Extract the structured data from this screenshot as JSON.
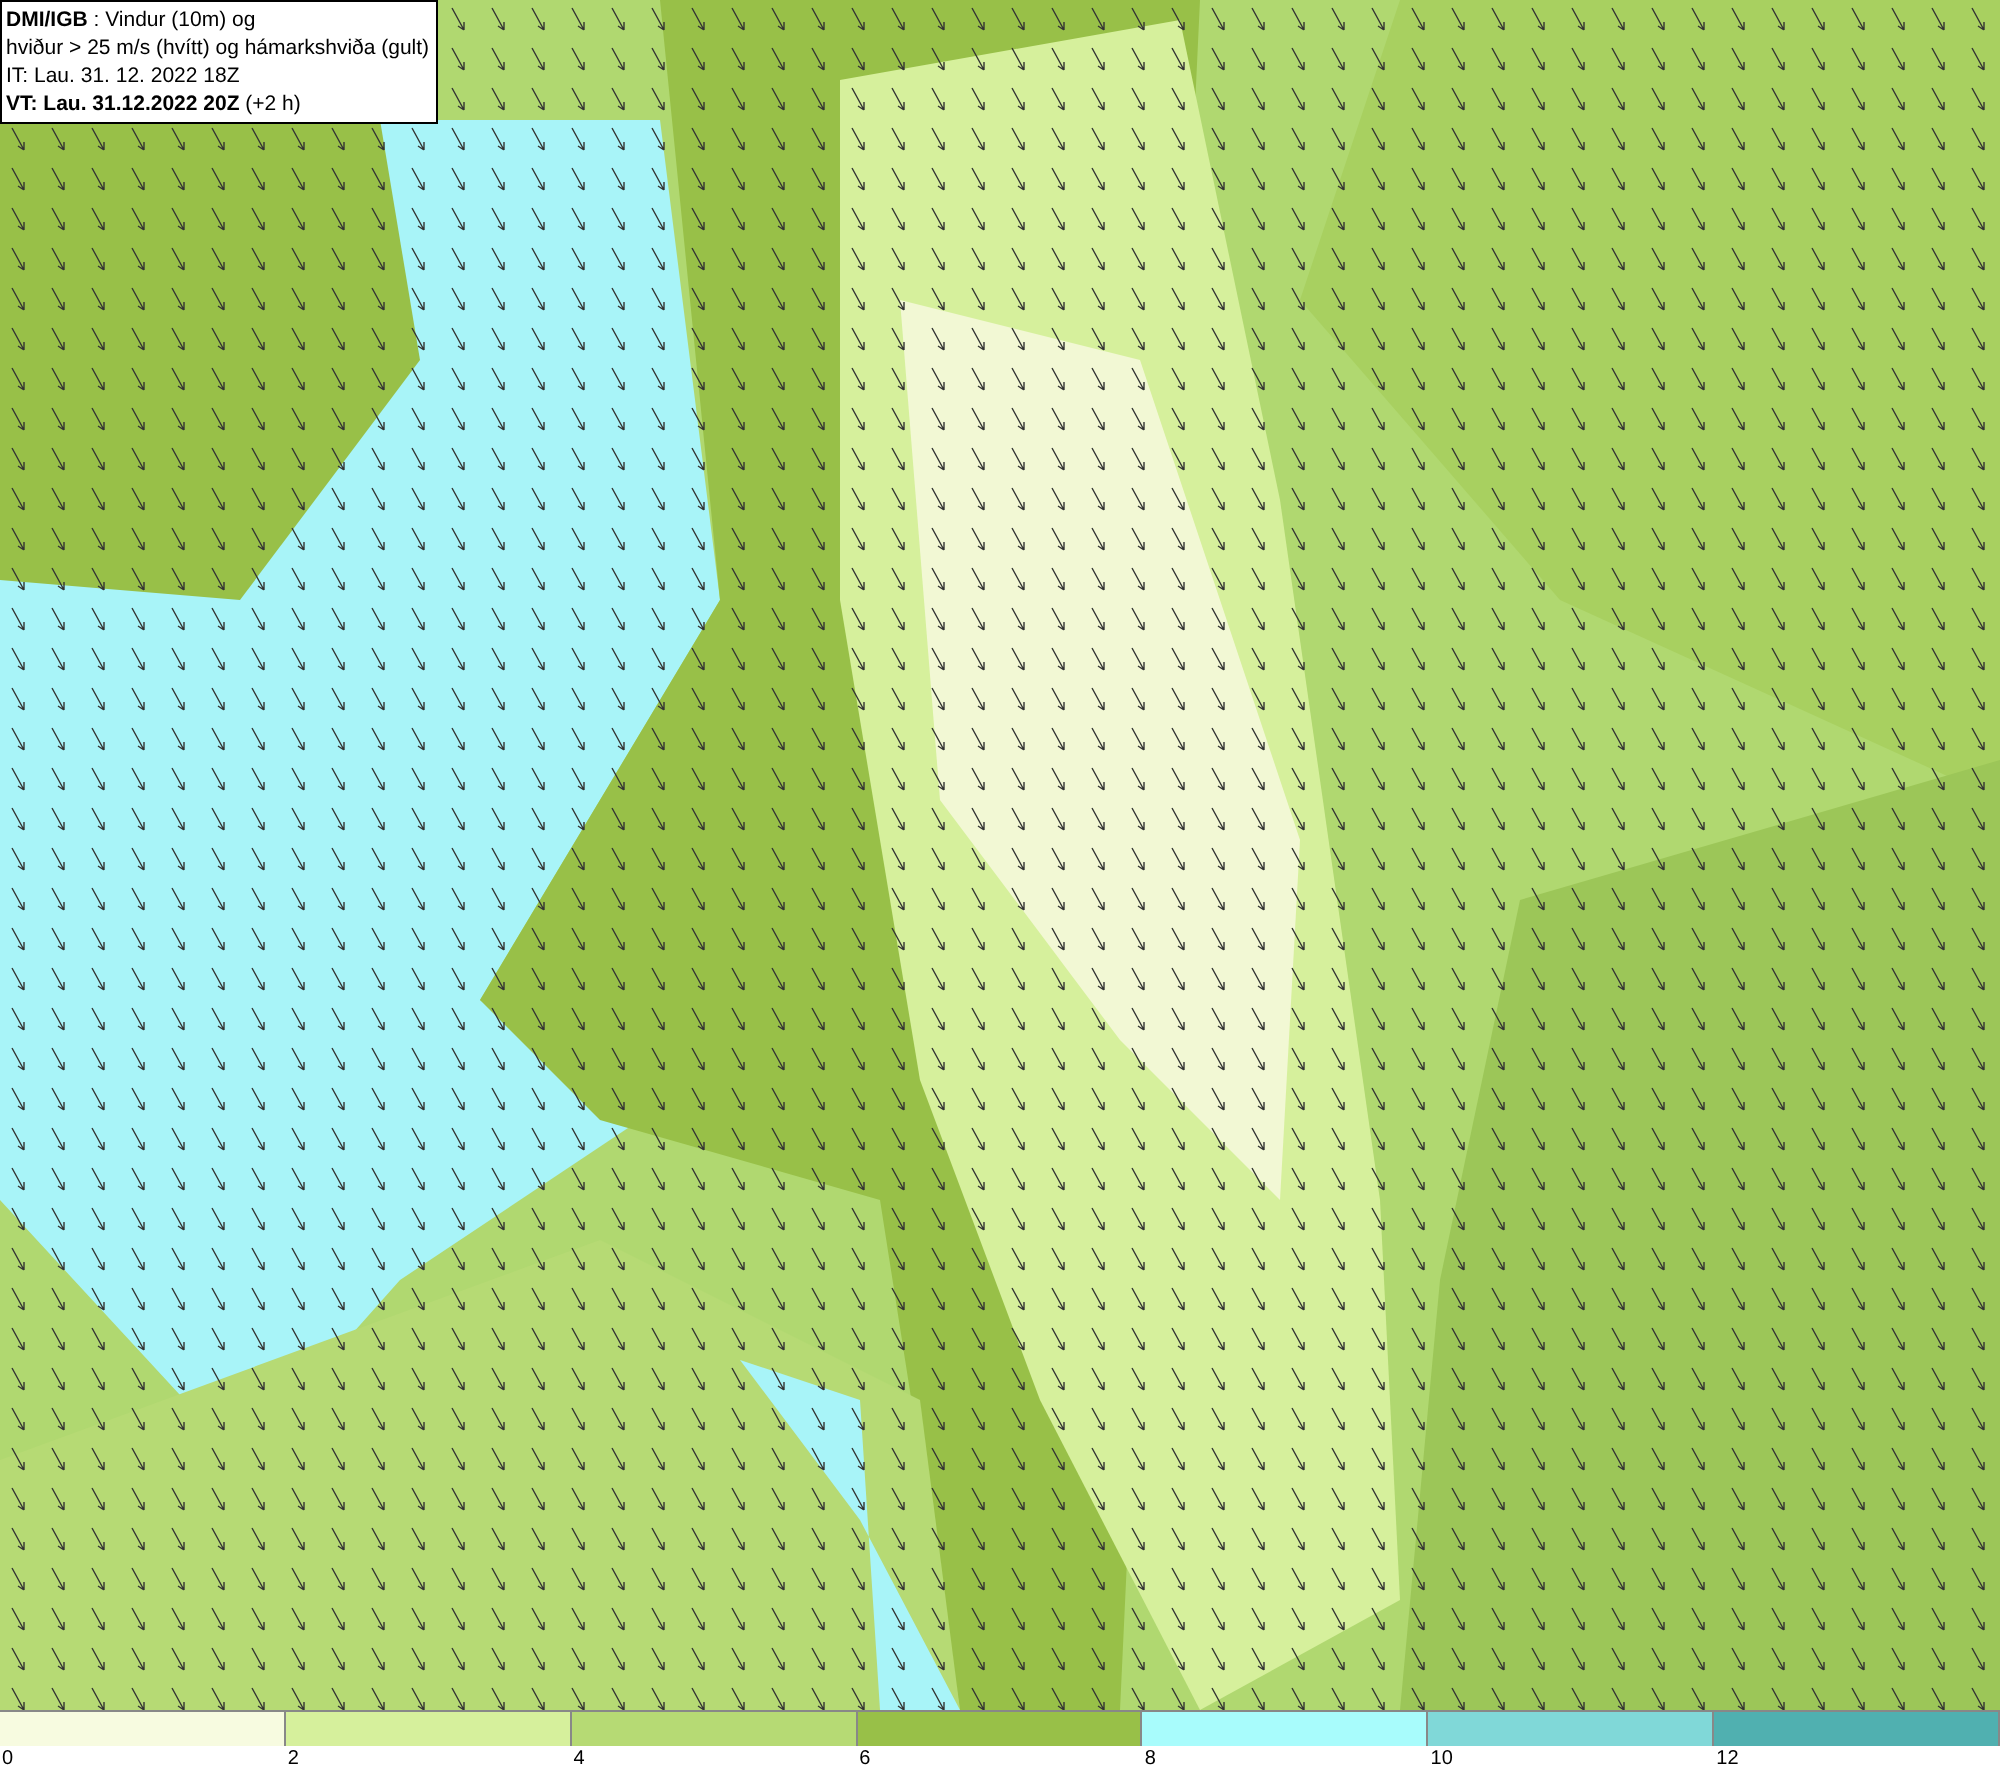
{
  "info_box": {
    "lines": [
      "**DMI/IGB** : Vindur (10m) og",
      "hviður > 25 m/s (hvítt) og hámarkshviða (gult)",
      "IT: Lau. 31. 12. 2022 18Z",
      "**VT: Lau. 31.12.2022 20Z** (+2 h)"
    ]
  },
  "legend": {
    "bins": [
      {
        "color": "#f7fbe0"
      },
      {
        "color": "#d6f09c"
      },
      {
        "color": "#b6da74"
      },
      {
        "color": "#98c048"
      },
      {
        "color": "#a8fcfc"
      },
      {
        "color": "#80d8d8"
      },
      {
        "color": "#50b0b0"
      }
    ],
    "ticks": [
      "0",
      "2",
      "4",
      "6",
      "8",
      "10",
      "12"
    ]
  }
}
